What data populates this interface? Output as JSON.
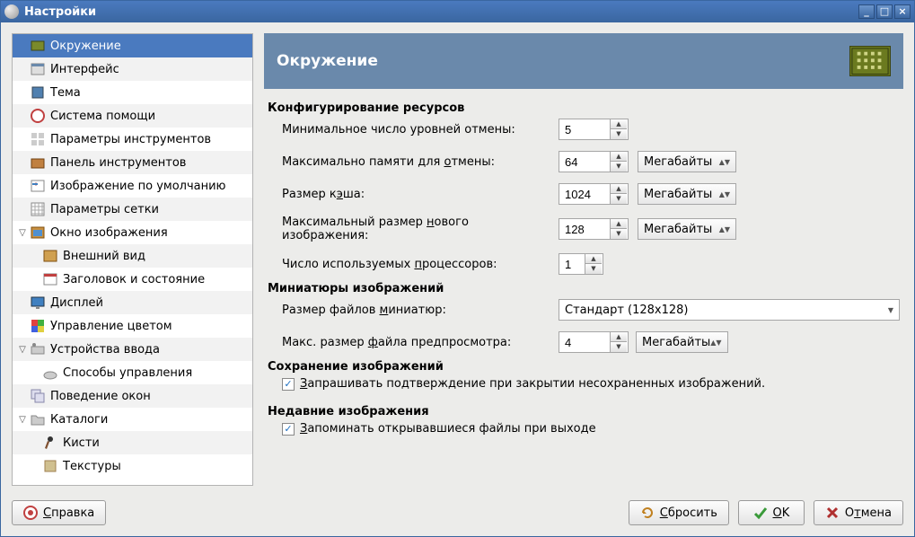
{
  "window_title": "Настройки",
  "sidebar": {
    "items": [
      {
        "label": "Окружение",
        "selected": true,
        "icon": "chip-icon"
      },
      {
        "label": "Интерфейс",
        "icon": "ui-icon"
      },
      {
        "label": "Тема",
        "icon": "theme-icon"
      },
      {
        "label": "Система помощи",
        "icon": "help-icon"
      },
      {
        "label": "Параметры инструментов",
        "icon": "tools-icon"
      },
      {
        "label": "Панель инструментов",
        "icon": "toolbox-icon"
      },
      {
        "label": "Изображение по умолчанию",
        "icon": "image-icon"
      },
      {
        "label": "Параметры сетки",
        "icon": "grid-icon"
      },
      {
        "label": "Окно изображения",
        "icon": "window-icon",
        "expandable": true,
        "expanded": true,
        "children": [
          {
            "label": "Внешний вид",
            "icon": "appearance-icon"
          },
          {
            "label": "Заголовок и состояние",
            "icon": "title-icon"
          }
        ]
      },
      {
        "label": "Дисплей",
        "icon": "display-icon"
      },
      {
        "label": "Управление цветом",
        "icon": "color-icon"
      },
      {
        "label": "Устройства ввода",
        "icon": "input-icon",
        "expandable": true,
        "expanded": true,
        "children": [
          {
            "label": "Способы управления",
            "icon": "controls-icon"
          }
        ]
      },
      {
        "label": "Поведение окон",
        "icon": "windows-icon"
      },
      {
        "label": "Каталоги",
        "icon": "folders-icon",
        "expandable": true,
        "expanded": true,
        "children": [
          {
            "label": "Кисти",
            "icon": "brushes-icon"
          },
          {
            "label": "Текстуры",
            "icon": "patterns-icon"
          }
        ]
      }
    ]
  },
  "header": {
    "title": "Окружение"
  },
  "sections": {
    "resources": {
      "title": "Конфигурирование ресурсов",
      "min_undo": {
        "label": "Минимальное число уровней отмены:",
        "value": "5"
      },
      "max_undo_mem": {
        "label": "Максимально памяти для отмены:",
        "value": "64",
        "unit": "Мегабайты"
      },
      "cache": {
        "label": "Размер кэша:",
        "value": "1024",
        "unit": "Мегабайты"
      },
      "max_new": {
        "label": "Максимальный размер нового изображения:",
        "value": "128",
        "unit": "Мегабайты"
      },
      "procs": {
        "label": "Число используемых процессоров:",
        "value": "1"
      }
    },
    "thumbs": {
      "title": "Миниатюры изображений",
      "size": {
        "label": "Размер файлов миниатюр:",
        "value": "Стандарт (128x128)"
      },
      "max_preview": {
        "label": "Макс. размер файла предпросмотра:",
        "value": "4",
        "unit": "Мегабайты"
      }
    },
    "saving": {
      "title": "Сохранение изображений",
      "confirm": {
        "label": "Запрашивать подтверждение при закрытии несохраненных изображений.",
        "checked": true
      }
    },
    "recent": {
      "title": "Недавние изображения",
      "remember": {
        "label": "Запоминать открывавшиеся файлы при выходе",
        "checked": true
      }
    }
  },
  "buttons": {
    "help": "Справка",
    "reset": "Сбросить",
    "ok": "OK",
    "cancel": "Отмена"
  }
}
